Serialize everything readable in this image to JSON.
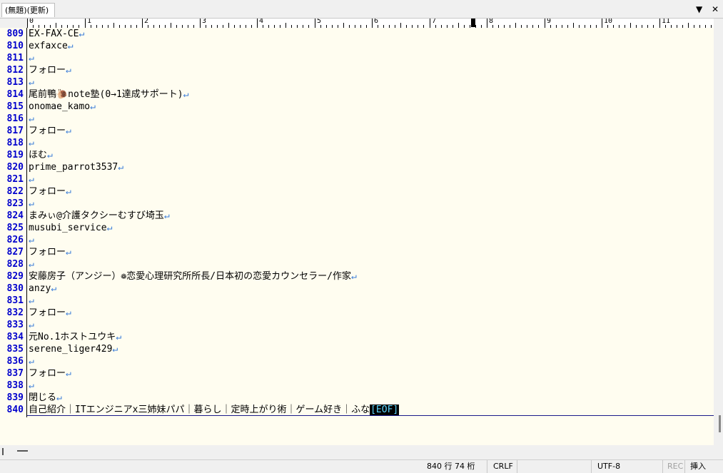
{
  "tab": {
    "title": "(無題)(更新)"
  },
  "tab_controls": {
    "dropdown": "▼",
    "close": "✕"
  },
  "ruler": {
    "labels": [
      "0",
      "1",
      "2",
      "3",
      "4",
      "5",
      "6",
      "7",
      "8",
      "9",
      "10",
      "11"
    ]
  },
  "lines": [
    {
      "num": "809",
      "text": "EX-FAX-CE",
      "ret": "↵"
    },
    {
      "num": "810",
      "text": "exfaxce",
      "ret": "↵"
    },
    {
      "num": "811",
      "text": "",
      "ret": "↵"
    },
    {
      "num": "812",
      "text": "フォロー",
      "ret": "↵"
    },
    {
      "num": "813",
      "text": "",
      "ret": "↵"
    },
    {
      "num": "814",
      "text": "尾前鴨🐌note塾(0→1達成サポート)",
      "ret": "↵"
    },
    {
      "num": "815",
      "text": "onomae_kamo",
      "ret": "↵"
    },
    {
      "num": "816",
      "text": "",
      "ret": "↵"
    },
    {
      "num": "817",
      "text": "フォロー",
      "ret": "↵"
    },
    {
      "num": "818",
      "text": "",
      "ret": "↵"
    },
    {
      "num": "819",
      "text": "ほむ",
      "ret": "↵"
    },
    {
      "num": "820",
      "text": "prime_parrot3537",
      "ret": "↵"
    },
    {
      "num": "821",
      "text": "",
      "ret": "↵"
    },
    {
      "num": "822",
      "text": "フォロー",
      "ret": "↵"
    },
    {
      "num": "823",
      "text": "",
      "ret": "↵"
    },
    {
      "num": "824",
      "text": "まみぃ@介護タクシーむすび埼玉",
      "ret": "↵"
    },
    {
      "num": "825",
      "text": "musubi_service",
      "ret": "↵"
    },
    {
      "num": "826",
      "text": "",
      "ret": "↵"
    },
    {
      "num": "827",
      "text": "フォロー",
      "ret": "↵"
    },
    {
      "num": "828",
      "text": "",
      "ret": "↵"
    },
    {
      "num": "829",
      "text": "安藤房子（アンジー）❁恋愛心理研究所所長/日本初の恋愛カウンセラー/作家",
      "ret": "↵"
    },
    {
      "num": "830",
      "text": "anzy",
      "ret": "↵"
    },
    {
      "num": "831",
      "text": "",
      "ret": "↵"
    },
    {
      "num": "832",
      "text": "フォロー",
      "ret": "↵"
    },
    {
      "num": "833",
      "text": "",
      "ret": "↵"
    },
    {
      "num": "834",
      "text": "元No.1ホストユウキ",
      "ret": "↵"
    },
    {
      "num": "835",
      "text": "serene_liger429",
      "ret": "↵"
    },
    {
      "num": "836",
      "text": "",
      "ret": "↵"
    },
    {
      "num": "837",
      "text": "フォロー",
      "ret": "↵"
    },
    {
      "num": "838",
      "text": "",
      "ret": "↵"
    },
    {
      "num": "839",
      "text": "閉じる",
      "ret": "↵"
    },
    {
      "num": "840",
      "text": "自己紹介｜ITエンジニアx三姉妹パパ｜暮らし｜定時上がり術｜ゲーム好き｜ふな",
      "eof": "[EOF]"
    }
  ],
  "status": {
    "position": "840 行  74 桁",
    "line_ending": "CRLF",
    "encoding": "UTF-8",
    "rec": "REC",
    "mode": "挿入"
  }
}
